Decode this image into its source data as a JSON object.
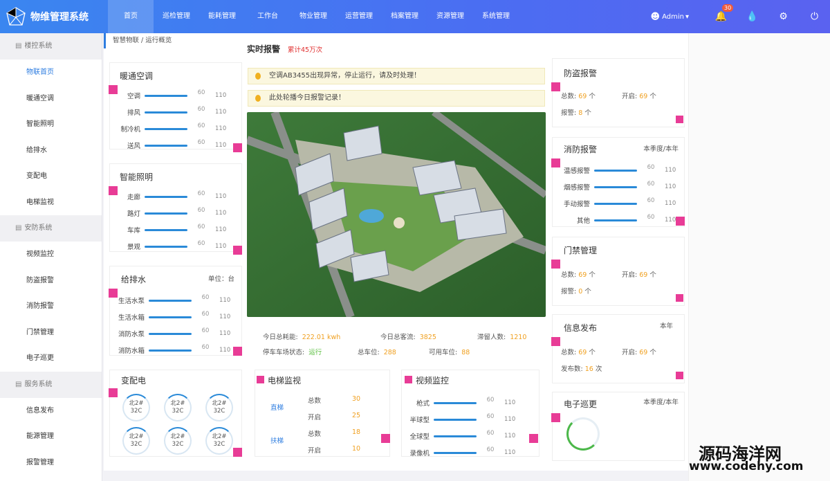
{
  "app": {
    "title": "物维管理系统"
  },
  "nav": [
    "首页",
    "巡检管理",
    "能耗管理",
    "工作台",
    "物业管理",
    "运营管理",
    "档案管理",
    "资源管理",
    "系统管理"
  ],
  "user": {
    "name": "Admin",
    "notif_count": "30"
  },
  "sidebar": {
    "sections": [
      {
        "label": "楼控系统",
        "items": [
          "物联首页",
          "暖通空调",
          "智能照明",
          "给排水",
          "变配电",
          "电梯监视"
        ]
      },
      {
        "label": "安防系统",
        "items": [
          "视频监控",
          "防盗报警",
          "消防报警",
          "门禁管理",
          "电子巡更"
        ]
      },
      {
        "label": "服务系统",
        "items": [
          "信息发布",
          "能源管理",
          "报警管理"
        ]
      }
    ]
  },
  "breadcrumb": "智慧物联 / 运行概览",
  "hvac": {
    "title": "暖通空调",
    "rows": [
      {
        "label": "空调",
        "v1": "60",
        "v2": "110"
      },
      {
        "label": "排风",
        "v1": "60",
        "v2": "110"
      },
      {
        "label": "制冷机",
        "v1": "60",
        "v2": "110"
      },
      {
        "label": "送风",
        "v1": "60",
        "v2": "110"
      }
    ]
  },
  "lighting": {
    "title": "智能照明",
    "rows": [
      {
        "label": "走廊",
        "v1": "60",
        "v2": "110"
      },
      {
        "label": "路灯",
        "v1": "60",
        "v2": "110"
      },
      {
        "label": "车库",
        "v1": "60",
        "v2": "110"
      },
      {
        "label": "景观",
        "v1": "60",
        "v2": "110"
      }
    ]
  },
  "water": {
    "title": "给排水",
    "unit": "单位：台",
    "rows": [
      {
        "label": "生活水泵",
        "v1": "60",
        "v2": "110"
      },
      {
        "label": "生活水箱",
        "v1": "60",
        "v2": "110"
      },
      {
        "label": "消防水泵",
        "v1": "60",
        "v2": "110"
      },
      {
        "label": "消防水箱",
        "v1": "60",
        "v2": "110"
      }
    ]
  },
  "power": {
    "title": "变配电",
    "rings": [
      {
        "a": "北2#",
        "b": "32C"
      },
      {
        "a": "北2#",
        "b": "32C"
      },
      {
        "a": "北2#",
        "b": "32C"
      },
      {
        "a": "北2#",
        "b": "32C"
      },
      {
        "a": "北2#",
        "b": "32C"
      },
      {
        "a": "北2#",
        "b": "32C"
      }
    ]
  },
  "alarm": {
    "title": "实时报警",
    "total": "累计45万次",
    "msg1": "空调AB3455出现异常，停止运行，请及时处理！",
    "msg2": "此处轮播今日报警记录！"
  },
  "stats": {
    "energy_label": "今日总耗能:",
    "energy": "222.01 kwh",
    "flow_label": "今日总客流:",
    "flow": "3825",
    "stay_label": "滞留人数:",
    "stay": "1210",
    "park_label": "停车车场状态:",
    "park": "运行",
    "total_label": "总车位:",
    "total": "288",
    "free_label": "可用车位:",
    "free": "88"
  },
  "elevator": {
    "title": "电梯监视",
    "g1": "直梯",
    "g2": "扶梯",
    "r1l": "总数",
    "r1v": "30",
    "r2l": "开启",
    "r2v": "25",
    "r3l": "总数",
    "r3v": "18",
    "r4l": "开启",
    "r4v": "10"
  },
  "video": {
    "title": "视频监控",
    "rows": [
      {
        "label": "枪式",
        "v1": "60",
        "v2": "110"
      },
      {
        "label": "半球型",
        "v1": "60",
        "v2": "110"
      },
      {
        "label": "全球型",
        "v1": "60",
        "v2": "110"
      },
      {
        "label": "录像机",
        "v1": "60",
        "v2": "110"
      }
    ]
  },
  "theft": {
    "title": "防盗报警",
    "total_l": "总数:",
    "total": "69",
    "unit": "个",
    "open_l": "开启:",
    "open": "69",
    "alarm_l": "报警:",
    "alarm": "8"
  },
  "fire": {
    "title": "消防报警",
    "period": "本季度/本年",
    "rows": [
      {
        "label": "温感报警",
        "v1": "60",
        "v2": "110"
      },
      {
        "label": "烟感报警",
        "v1": "60",
        "v2": "110"
      },
      {
        "label": "手动报警",
        "v1": "60",
        "v2": "110"
      },
      {
        "label": "其他",
        "v1": "60",
        "v2": "110"
      }
    ]
  },
  "access": {
    "title": "门禁管理",
    "total_l": "总数:",
    "total": "69",
    "unit": "个",
    "open_l": "开启:",
    "open": "69",
    "alarm_l": "报警:",
    "alarm": "0"
  },
  "info": {
    "title": "信息发布",
    "period": "本年",
    "total_l": "总数:",
    "total": "69",
    "unit": "个",
    "open_l": "开启:",
    "open": "69",
    "pub_l": "发布数:",
    "pub": "16",
    "pub_unit": "次"
  },
  "patrol": {
    "title": "电子巡更",
    "period": "本季度/本年"
  },
  "watermark": {
    "cn": "源码海洋网",
    "url": "www.codehy.com"
  },
  "colors": {
    "accent": "#2e7de0",
    "pink": "#e83c96",
    "yellow": "#f0a020"
  }
}
